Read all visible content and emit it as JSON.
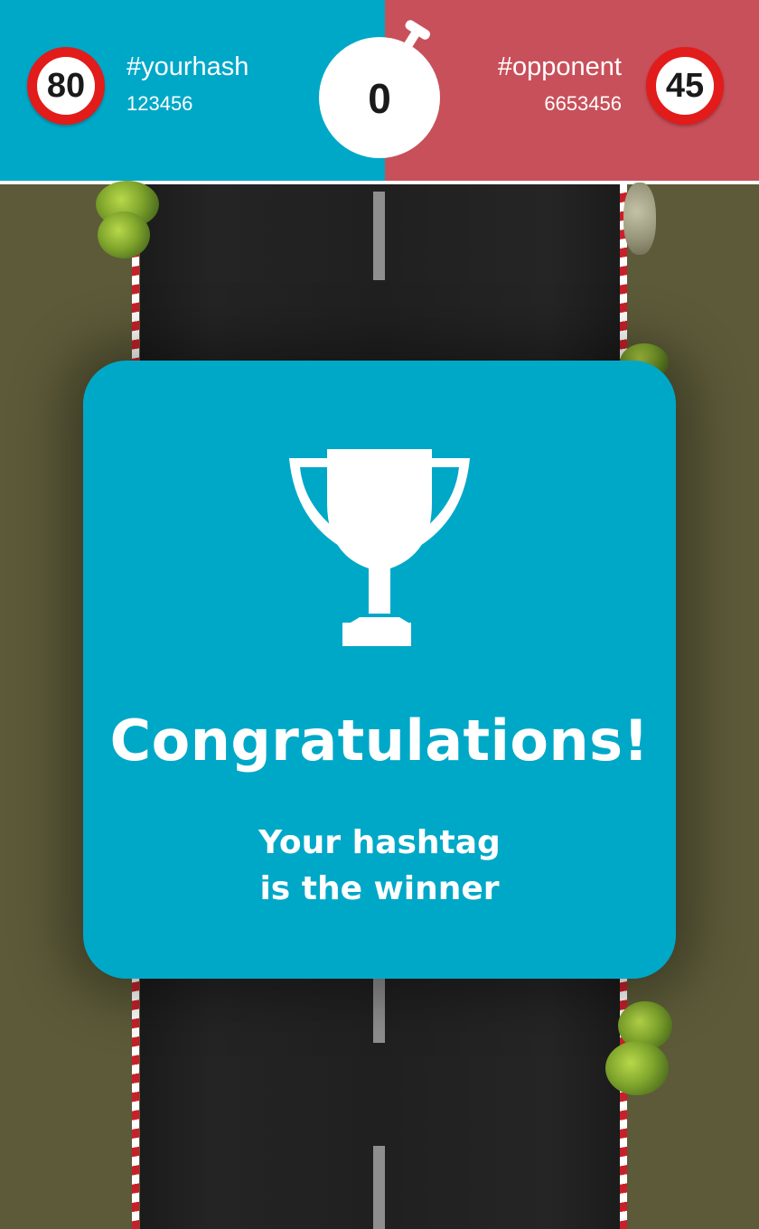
{
  "header": {
    "you": {
      "speed": "80",
      "hashtag": "#yourhash",
      "count": "123456",
      "color": "#00a8c8"
    },
    "opponent": {
      "speed": "45",
      "hashtag": "#opponent",
      "count": "6653456",
      "color": "#c8505a"
    },
    "timer": "0",
    "icons": {
      "speed_sign": "speed-limit-sign-icon",
      "timer": "stopwatch-icon"
    }
  },
  "card": {
    "icon": "trophy-icon",
    "title": "Congratulations!",
    "message_line1": "Your hashtag",
    "message_line2": "is the winner",
    "color": "#00a8c8"
  }
}
